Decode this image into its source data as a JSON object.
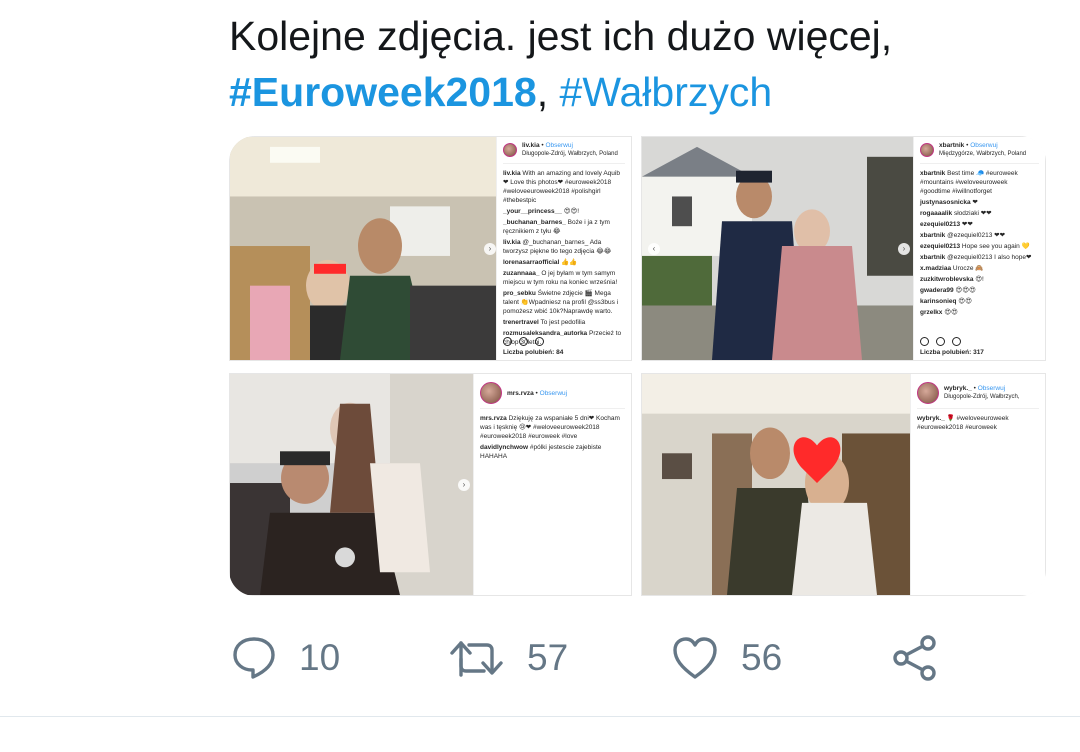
{
  "tweet": {
    "text_line1": "Kolejne zdjęcia. jest ich dużo więcej,",
    "hashtag1": "#Euroweek2018",
    "separator": ",",
    "hashtag2": "#Wałbrzych"
  },
  "media": {
    "tile1": {
      "username": "liv.kia",
      "follow": "Obserwuj",
      "location": "Długopole-Zdrój, Wałbrzych, Poland",
      "comments": [
        {
          "user": "liv.kia",
          "text": "With an amazing and lovely Aquib ❤ Love this photos❤ #euroweek2018 #weloveeuroweek2018 #polishgirl #thebestpic"
        },
        {
          "user": "_your__princess__",
          "text": "😍😍!"
        },
        {
          "user": "_buchanan_barnes_",
          "text": "Boże i ja z tym ręcznikiem z tyłu 😂"
        },
        {
          "user": "liv.kia",
          "text": "@_buchanan_barnes_ Ada tworzysz piękne tło tego zdjęcia 😂😂"
        },
        {
          "user": "lorenasarraofficial",
          "text": "👍👍"
        },
        {
          "user": "zuzannaaa_",
          "text": "O jej byłam w tym samym miejscu w tym roku na koniec września!"
        },
        {
          "user": "pro_sebku",
          "text": "Świetne zdjęcie 🎬 Mega talent 👏Wpadniesz na profil @ss3bus i pomożesz wbić 10k?Naprawdę warto."
        },
        {
          "user": "trenertravel",
          "text": "To jest pedofilia"
        },
        {
          "user": "rozmusaleksandra_autorka",
          "text": "Przecież to chłop 30letni."
        }
      ],
      "likes": "Liczba polubień: 84"
    },
    "tile2": {
      "username": "xbartnik",
      "follow": "Obserwuj",
      "location": "Międzygórze, Wałbrzych, Poland",
      "comments": [
        {
          "user": "xbartnik",
          "text": "Best time 🧢 #euroweek #mountains #weloveeuroweek #goodtime #iwillnotforget"
        },
        {
          "user": "justynasosnicka",
          "text": "❤"
        },
        {
          "user": "rogaaaalik",
          "text": "słodziaki ❤❤"
        },
        {
          "user": "ezequiel0213",
          "text": "❤❤"
        },
        {
          "user": "xbartnik",
          "text": "@ezequiel0213 ❤❤"
        },
        {
          "user": "ezequiel0213",
          "text": "Hope see you again 💛"
        },
        {
          "user": "xbartnik",
          "text": "@ezequiel0213 I also hope❤"
        },
        {
          "user": "x.madziaa",
          "text": "Urocze 🙈"
        },
        {
          "user": "zuzkitwroblevska",
          "text": "😍!"
        },
        {
          "user": "gwadera99",
          "text": "😍😍😍"
        },
        {
          "user": "karinsonieq",
          "text": "😍😍"
        },
        {
          "user": "grzelkx",
          "text": "😍😍"
        }
      ],
      "likes": "Liczba polubień: 317"
    },
    "tile3": {
      "username": "mrs.rvza",
      "follow": "Obserwuj",
      "comments": [
        {
          "user": "mrs.rvza",
          "text": "Dziękuję za wspaniałe 5 dni❤ Kocham was i tęsknię 😢❤ #weloveeuroweek2018 #euroweek2018 #euroweek #love"
        },
        {
          "user": "davidlynchwow",
          "text": "#pólki jestescie zajebiste HAHAHA"
        }
      ]
    },
    "tile4": {
      "username": "wybryk._",
      "follow": "Obserwuj",
      "location": "Długopole-Zdrój, Wałbrzych,",
      "comments": [
        {
          "user": "wybryk._",
          "text": "🌹 #weloveeuroweek #euroweek2018 #euroweek"
        }
      ]
    }
  },
  "actions": {
    "reply_count": "10",
    "retweet_count": "57",
    "like_count": "56"
  },
  "colors": {
    "hashtag": "#1b95e0",
    "action_gray": "#657786",
    "text": "#14171a"
  },
  "icons": [
    "reply-icon",
    "retweet-icon",
    "like-icon",
    "share-icon"
  ]
}
